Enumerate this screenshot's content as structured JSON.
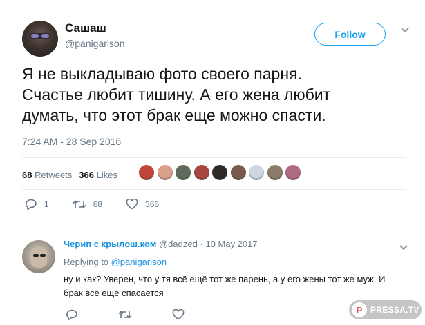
{
  "tweet": {
    "author": {
      "display_name": "Сашаш",
      "handle": "@panigarison"
    },
    "follow_label": "Follow",
    "text_lines": [
      "Я не выкладываю фото своего парня.",
      "Счастье любит тишину. А его жена любит",
      "думать, что этот брак еще можно спасти."
    ],
    "timestamp": "7:24 AM - 28 Sep 2016",
    "stats": {
      "retweets_count": "68",
      "retweets_label": "Retweets",
      "likes_count": "366",
      "likes_label": "Likes"
    },
    "liker_avatar_colors": [
      "#c0453a",
      "#d9a089",
      "#5f6b5a",
      "#a8453f",
      "#2e2a2a",
      "#7a5a4f",
      "#cfd6e0",
      "#8c7a6a",
      "#b06a82"
    ],
    "actions": {
      "reply_count": "1",
      "retweet_count": "68",
      "like_count": "366"
    }
  },
  "reply": {
    "display_name": "Черип с крылош.ком",
    "handle": "@dadzed",
    "date": "10 May 2017",
    "replying_to_label": "Replying to",
    "replying_to_handle": "@panigarison",
    "text_lines": [
      "ну и как? Уверен, что у тя всё ещё тот же парень, а у его жены тот же муж. И",
      "брак всё ещё спасается"
    ]
  },
  "watermark": {
    "logo_letter": "P",
    "text": "PRESSA.TV"
  },
  "colors": {
    "accent": "#1da1f2",
    "link": "#1b95e0",
    "muted": "#657786",
    "text": "#14171a",
    "divider": "#e6ecf0"
  },
  "icons": [
    "reply-icon",
    "retweet-icon",
    "like-icon",
    "chevron-down-icon"
  ]
}
